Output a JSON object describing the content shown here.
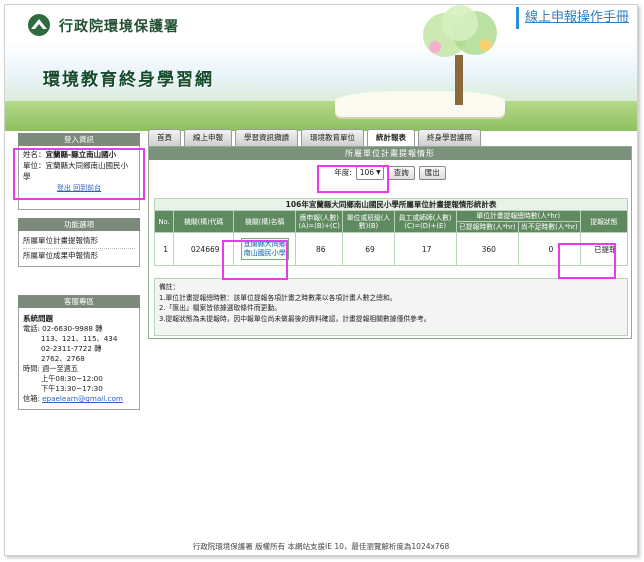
{
  "header": {
    "org_name": "行政院環境保護署",
    "site_title": "環境教育終身學習網",
    "manual_link": "線上申報操作手冊"
  },
  "tabs": [
    {
      "label": "首頁"
    },
    {
      "label": "線上申報"
    },
    {
      "label": "學習資訊擷讀"
    },
    {
      "label": "環境教育單位"
    },
    {
      "label": "統計報表"
    },
    {
      "label": "終身學習護照"
    }
  ],
  "sidebar": {
    "user_head": "登入資訊",
    "user_name_label": "姓名：",
    "user_name": "宜蘭縣-縣立南山國小",
    "unit_label": "單位：",
    "unit_value": "宜蘭縣大同鄉南山國民小學",
    "logout": "登出 回到前台",
    "func_head": "功能選項",
    "func_items": [
      {
        "label": "所屬單位計畫提報情形"
      },
      {
        "label": "所屬單位成果申報情形"
      }
    ],
    "service_head": "客服專區",
    "service": {
      "title": "系統問題",
      "phone_label": "電話: 02-6630-9988 轉",
      "phone_ext1": "113、121、115、434",
      "phone2": "02-2311-7722 轉",
      "phone2_ext": "2762、2768",
      "hours_label": "時間: 週一至週五",
      "hours_am": "上午08:30~12:00",
      "hours_pm": "下午13:30~17:30",
      "mail_label": "信箱: ",
      "mail": "epaelearn@gmail.com"
    }
  },
  "main": {
    "head": "所屬單位計畫提報情形",
    "year_label": "年度:",
    "year_value": "106",
    "query_button": "查詢",
    "export_button": "匯出",
    "table_title": "106年宜蘭縣大同鄉南山國民小學所屬單位計畫提報情形統計表",
    "headers": {
      "no": "No.",
      "code": "機關(構)代碼",
      "name": "機關(構)名稱",
      "should": "應申報(人數)(A)=(B)+(C)",
      "staff": "單位或班級(人數)(B)",
      "worker": "員工或師師(人數)(C)=(D)+(E)",
      "hours_group": "單位計畫提報總時數(人*hr)",
      "reported_hours": "已提報時數(人*hr)",
      "shortfall": "尚不足時數(人*hr)",
      "status": "提報狀態"
    },
    "rows": [
      {
        "no": "1",
        "code": "024669",
        "name_line1": "宜蘭縣大同鄉",
        "name_line2": "南山國民小學",
        "should": "86",
        "staff": "69",
        "worker": "17",
        "reported_hours": "360",
        "shortfall": "0",
        "status": "已提報"
      }
    ],
    "notes": [
      "備註：",
      "1.單位計畫提報總時數：該單位提報各項計畫之時數乘以各項計畫人數之總和。",
      "2.「匯出」檔案皆依據選取條件而更動。",
      "3.提報狀態為未提報時，因中報單位尚未做最後的資料確認，計畫提報相關數據僅供參考。"
    ]
  },
  "footer": "行政院環境保護署 版權所有 本網站支援IE 10，最佳瀏覽解析度為1024x768",
  "colors": {
    "highlight": "#e83ce8",
    "header_green": "#5f8a5f",
    "link_blue": "#2a7fc6"
  }
}
